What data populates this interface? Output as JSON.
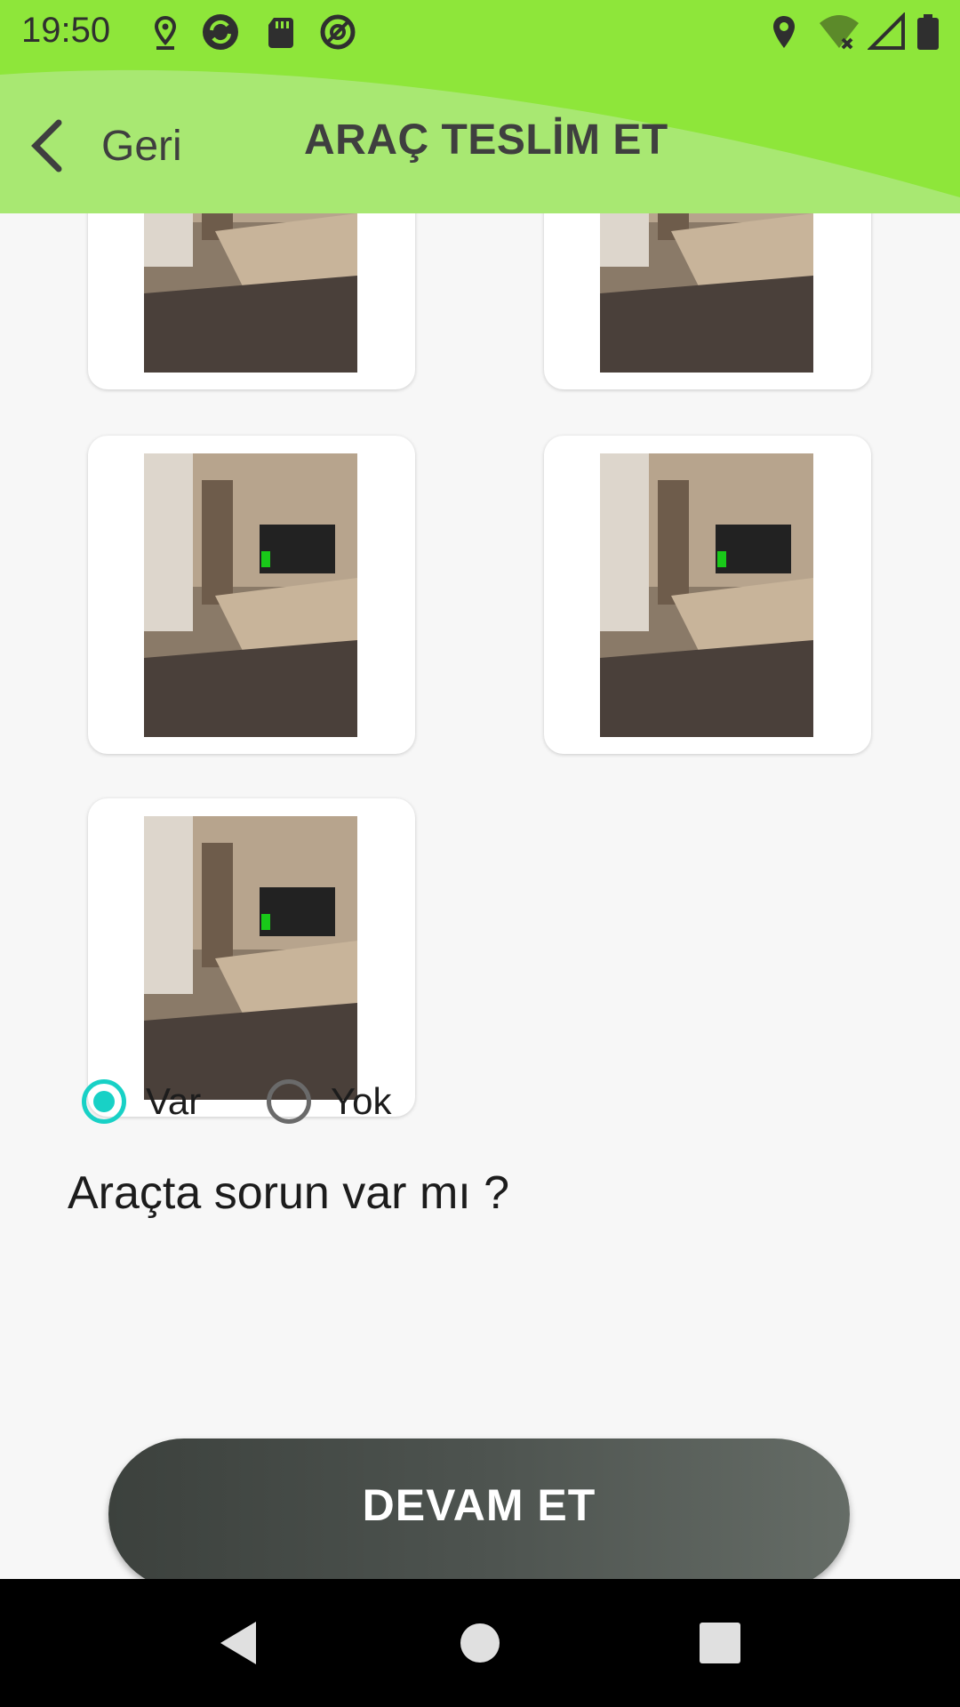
{
  "status_bar": {
    "time": "19:50",
    "left_icons": [
      "location-icon",
      "sync-icon",
      "sd-card-icon",
      "no-disturb-icon"
    ],
    "right_icons": [
      "location-icon",
      "wifi-icon",
      "signal-icon",
      "battery-icon"
    ]
  },
  "header": {
    "back_label": "Geri",
    "title": "ARAÇ TESLİM ET",
    "bg_color": "#8ee63a"
  },
  "photos": {
    "count_visible": 5,
    "items": [
      "photo-1",
      "photo-2",
      "photo-3",
      "photo-4",
      "photo-5"
    ]
  },
  "question": {
    "text": "Araçta sorun var mı ?",
    "options": [
      {
        "label": "Var",
        "checked": true
      },
      {
        "label": "Yok",
        "checked": false
      }
    ],
    "accent_color": "#18d1c6"
  },
  "continue_button": {
    "label": "DEVAM ET"
  },
  "nav_bar": {
    "buttons": [
      "back-icon",
      "home-icon",
      "recents-icon"
    ]
  }
}
